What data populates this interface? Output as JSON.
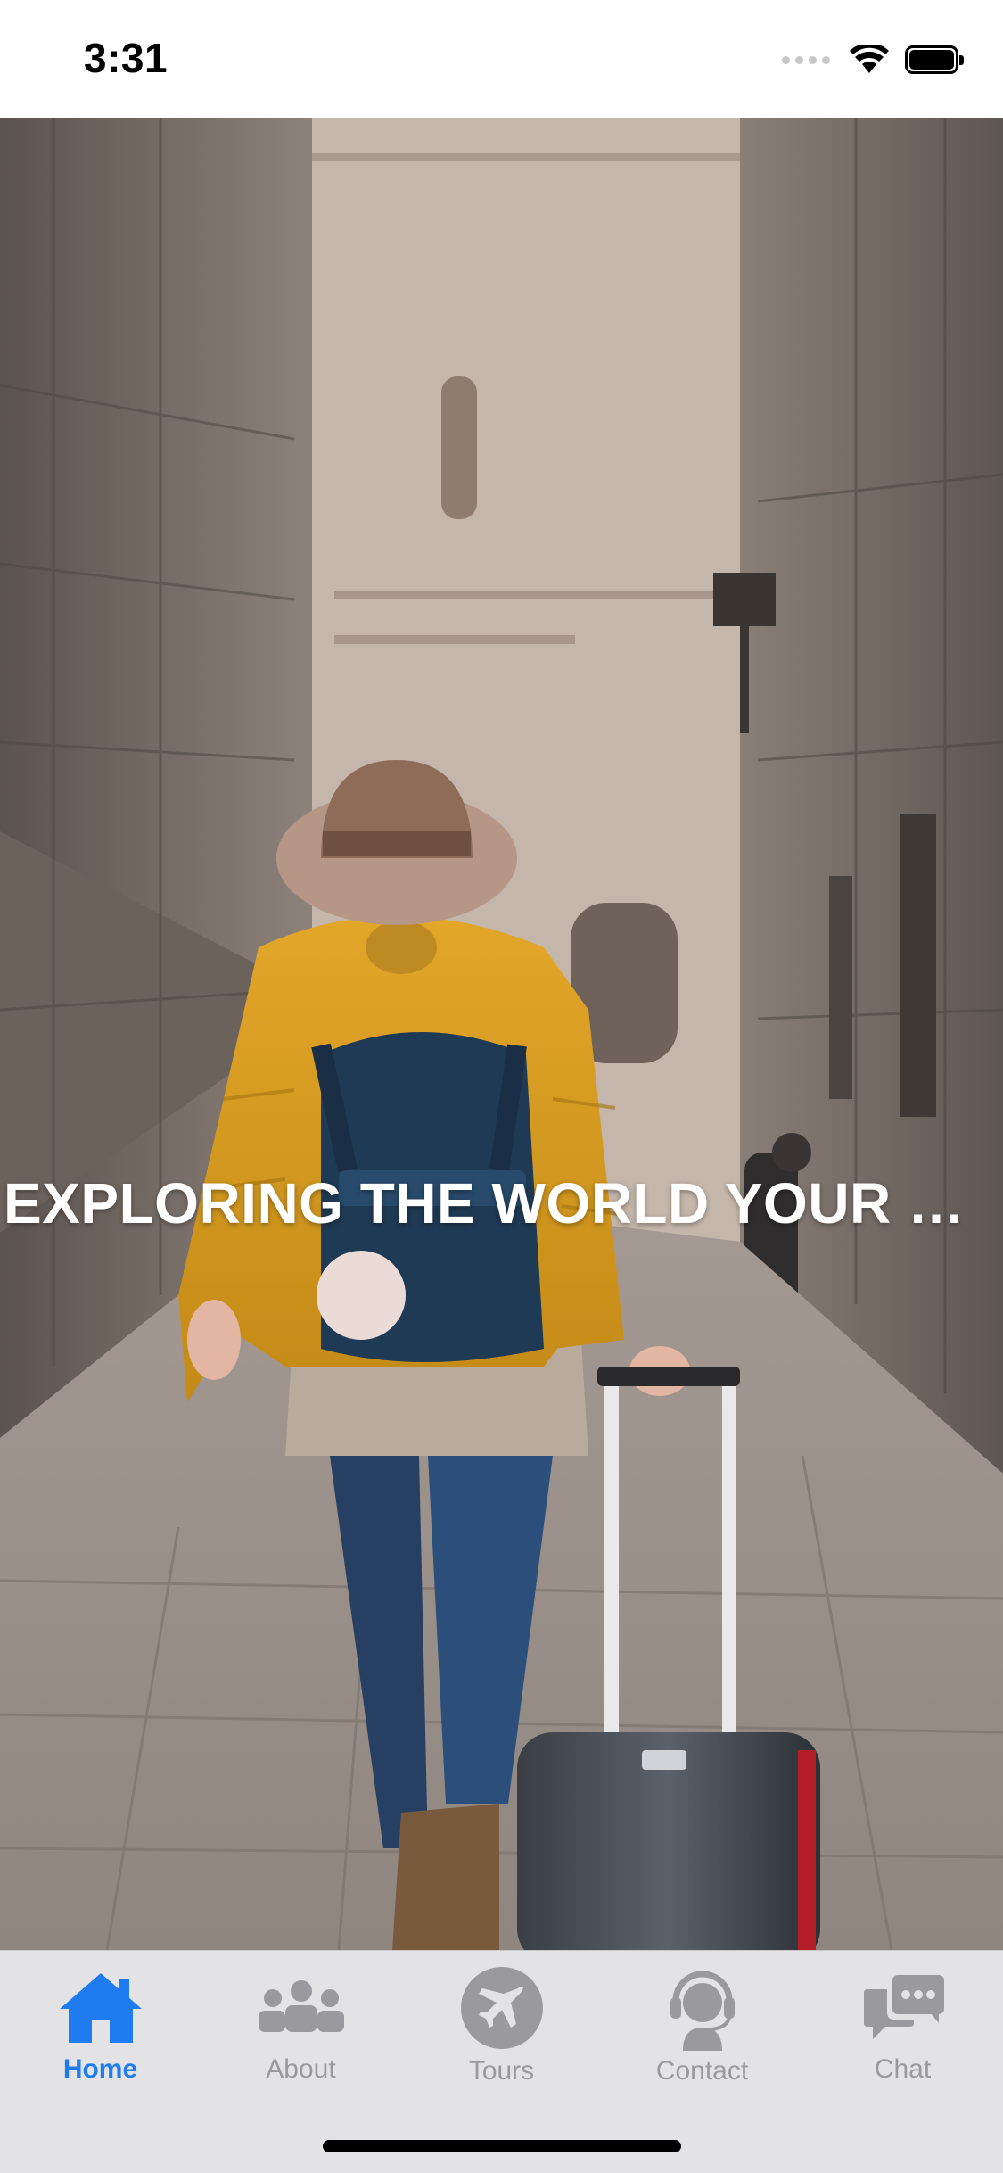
{
  "status_bar": {
    "time": "3:31",
    "icons": [
      "signal-icon",
      "wifi-icon",
      "battery-icon"
    ]
  },
  "hero": {
    "title": "EXPLORING THE WORLD YOUR WAY",
    "image_description": "traveler-with-hat-backpack-and-suitcase-in-stone-alley"
  },
  "tab_bar": {
    "accent_color": "#1e7cf0",
    "inactive_color": "#9a9a9e",
    "tabs": [
      {
        "label": "Home",
        "icon": "home-icon",
        "active": true
      },
      {
        "label": "About",
        "icon": "people-icon",
        "active": false
      },
      {
        "label": "Tours",
        "icon": "airplane-icon",
        "active": false
      },
      {
        "label": "Contact",
        "icon": "headset-icon",
        "active": false
      },
      {
        "label": "Chat",
        "icon": "chat-bubbles-icon",
        "active": false
      }
    ]
  }
}
